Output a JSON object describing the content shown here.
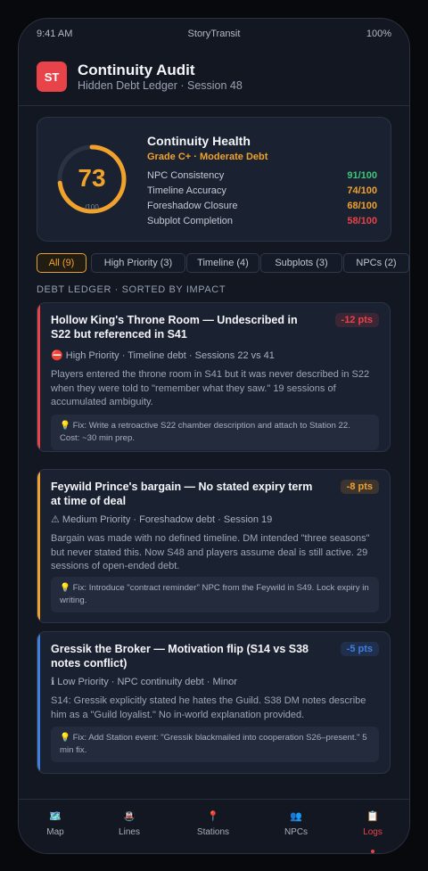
{
  "status_bar": {
    "time": "9:41 AM",
    "app": "StoryTransit",
    "battery": "100%"
  },
  "header": {
    "logo": "ST",
    "title": "Continuity Audit",
    "subtitle": "Hidden Debt Ledger · Session 48"
  },
  "health": {
    "score": "73",
    "score_max": "/100",
    "score_fraction": 0.73,
    "title": "Continuity Health",
    "grade": "Grade C+ · Moderate Debt",
    "metrics": [
      {
        "label": "NPC Consistency",
        "value": "91/100",
        "color": "#3ec77a"
      },
      {
        "label": "Timeline Accuracy",
        "value": "74/100",
        "color": "#f0a22c"
      },
      {
        "label": "Foreshadow Closure",
        "value": "68/100",
        "color": "#f0a22c"
      },
      {
        "label": "Subplot Completion",
        "value": "58/100",
        "color": "#e84349"
      }
    ]
  },
  "filters": [
    "All (9)",
    "High Priority (3)",
    "Timeline (4)",
    "Subplots (3)",
    "NPCs (2)"
  ],
  "section_label": "DEBT LEDGER · SORTED BY IMPACT",
  "cards": [
    {
      "title": "Hollow King's Throne Room — Undescribed in S22 but referenced in S41",
      "points": "-12 pts",
      "accent": "#e84349",
      "priority_icon": "no-entry-icon",
      "meta": "⛔ High Priority · Timeline debt · Sessions 22 vs 41",
      "description": "Players entered the throne room in S41 but it was never described in S22 when they were told to \"remember what they saw.\" 19 sessions of accumulated ambiguity.",
      "fix": "💡 Fix: Write a retroactive S22 chamber description and attach to Station 22. Cost: ~30 min prep."
    },
    {
      "title": "Feywild Prince's bargain — No stated expiry term at time of deal",
      "points": "-8 pts",
      "accent": "#f0a22c",
      "priority_icon": "warning-icon",
      "meta": "⚠ Medium Priority · Foreshadow debt · Session 19",
      "description": "Bargain was made with no defined timeline. DM intended \"three seasons\" but never stated this. Now S48 and players assume deal is still active. 29 sessions of open-ended debt.",
      "fix": "💡 Fix: Introduce \"contract reminder\" NPC from the Feywild in S49. Lock expiry in writing."
    },
    {
      "title": "Gressik the Broker — Motivation flip (S14 vs S38 notes conflict)",
      "points": "-5 pts",
      "accent": "#3f7fe0",
      "priority_icon": "info-icon",
      "meta": "ℹ Low Priority · NPC continuity debt · Minor",
      "description": "S14: Gressik explicitly stated he hates the Guild. S38 DM notes describe him as a \"Guild loyalist.\" No in-world explanation provided.",
      "fix": "💡 Fix: Add Station event: \"Gressik blackmailed into cooperation S26–present.\" 5 min fix."
    }
  ],
  "nav": [
    {
      "label": "Map",
      "icon": "🗺️"
    },
    {
      "label": "Lines",
      "icon": "🚇"
    },
    {
      "label": "Stations",
      "icon": "📍"
    },
    {
      "label": "NPCs",
      "icon": "👥"
    },
    {
      "label": "Logs",
      "icon": "📋",
      "active": true
    }
  ],
  "colors": {
    "accent": "#f0a22c",
    "danger": "#e84349",
    "success": "#3ec77a",
    "info": "#3f7fe0"
  }
}
